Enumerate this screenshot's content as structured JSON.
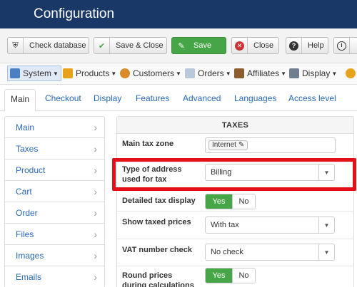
{
  "header": {
    "title": "Configuration"
  },
  "toolbar": {
    "check_database": "Check database",
    "save_close": "Save & Close",
    "save": "Save",
    "close": "Close",
    "help": "Help"
  },
  "menubar": {
    "system": "System",
    "products": "Products",
    "customers": "Customers",
    "orders": "Orders",
    "affiliates": "Affiliates",
    "display": "Display"
  },
  "tabs": {
    "main": "Main",
    "checkout": "Checkout",
    "display": "Display",
    "features": "Features",
    "advanced": "Advanced",
    "languages": "Languages",
    "access_level": "Access level"
  },
  "sidebar": {
    "items": [
      {
        "label": "Main"
      },
      {
        "label": "Taxes"
      },
      {
        "label": "Product"
      },
      {
        "label": "Cart"
      },
      {
        "label": "Order"
      },
      {
        "label": "Files"
      },
      {
        "label": "Images"
      },
      {
        "label": "Emails"
      }
    ]
  },
  "taxes": {
    "heading": "TAXES",
    "main_tax_zone_label": "Main tax zone",
    "main_tax_zone_value": "Internet",
    "address_type_label": "Type of address used for tax",
    "address_type_value": "Billing",
    "detailed_label": "Detailed tax display",
    "show_taxed_label": "Show taxed prices",
    "show_taxed_value": "With tax",
    "vat_label": "VAT number check",
    "vat_value": "No check",
    "round_label": "Round prices during calculations",
    "yes": "Yes",
    "no": "No"
  },
  "colors": {
    "header_bg": "#1a3867",
    "save_green": "#46a546",
    "highlight_red": "#e3101a",
    "link_blue": "#2a69b8"
  },
  "icons": [
    "shield-icon",
    "check-icon",
    "edit-icon",
    "close-circle-icon",
    "question-icon",
    "info-icon",
    "wrench-icon",
    "pencil-icon",
    "chevron-right-icon",
    "caret-down-icon"
  ]
}
